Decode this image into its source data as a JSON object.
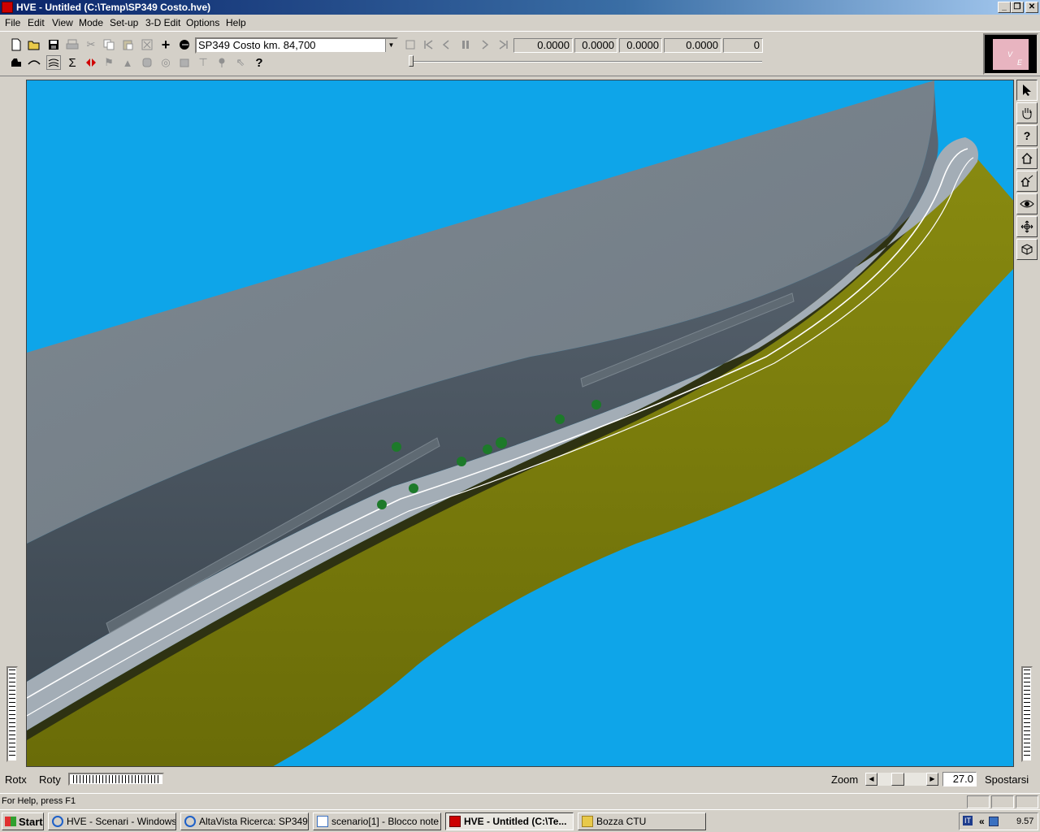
{
  "window": {
    "title": "HVE - Untitled (C:\\Temp\\SP349 Costo.hve)",
    "minimize_glyph": "_",
    "restore_glyph": "❐",
    "close_glyph": "✕"
  },
  "menu": {
    "items": [
      "File",
      "Edit",
      "View",
      "Mode",
      "Set-up",
      "3-D Edit",
      "Options",
      "Help"
    ]
  },
  "toolbar": {
    "environment_select": "SP349 Costo km. 84,700",
    "playback_readouts": [
      "0.0000",
      "0.0000",
      "0.0000",
      "0.0000",
      "0"
    ],
    "help_glyph": "?"
  },
  "logo": {
    "text_v": "V",
    "text_e": "E"
  },
  "right_toolbar": {
    "icons": [
      "select-arrow-icon",
      "hand-pan-icon",
      "help-icon",
      "home-icon",
      "home-zoom-icon",
      "eye-icon",
      "move-icon",
      "view-cube-icon"
    ]
  },
  "bottom_controls": {
    "rotx_label": "Rotx",
    "roty_label": "Roty",
    "zoom_label": "Zoom",
    "zoom_value": "27.0",
    "mode_label": "Spostarsi"
  },
  "status": {
    "help_text": "For Help, press F1"
  },
  "taskbar": {
    "start_label": "Start",
    "items": [
      {
        "label": "HVE - Scenari - Windows ...",
        "active": false
      },
      {
        "label": "AltaVista Ricerca: SP349 ...",
        "active": false
      },
      {
        "label": "scenario[1] - Blocco note",
        "active": false
      },
      {
        "label": "HVE - Untitled (C:\\Te...",
        "active": true
      },
      {
        "label": "Bozza CTU",
        "active": false
      }
    ],
    "clock": "9.57",
    "tray_chevron": "«",
    "lang_indicator": "IT"
  },
  "colors": {
    "sky": "#0ea5e9",
    "rock": "#6b7680",
    "embankment": "#7a7d10",
    "road": "#9aa3ab",
    "tree": "#1d7a2a"
  }
}
